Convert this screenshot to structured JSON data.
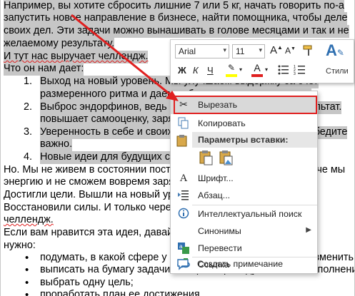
{
  "document": {
    "para1": [
      "Например, вы хотите сбросить лишние 7 или 5 кг, начать говорить по-а",
      "запустить новое направление в бизнесе, найти помощника, чтобы деле",
      "своих дел. Эти задачи можно вынашивать в голове месяцами и так и не",
      "желаемому результату."
    ],
    "line5": "И тут нас выручает челлендж.",
    "line6": "Что он нам дает:",
    "numbered": [
      {
        "n": "1.",
        "lines": [
          "Выход на новый уровень. Мы улучшаем выдержку за счет",
          "размеренного ритма и даем себе импульс для развития."
        ]
      },
      {
        "n": "2.",
        "lines": [
          "Выброс эндорфинов, ведь мы получаем конкретный результат.",
          "повышает самооценку, заряжает энергией."
        ]
      },
      {
        "n": "3.",
        "lines": [
          "Уверенность в себе и своих силах. Вы уже знаете, что победите",
          "важно."
        ]
      },
      {
        "n": "4.",
        "lines": [
          "Новые идеи для будущих свершений."
        ]
      }
    ],
    "para2": [
      "Но. Мы не живем в состоянии постоянного роста и развития. Иначе мы",
      "энергию и не сможем вовремя зарядиться.",
      "Достигли цели. Вышли на новый уровень. Но через время надо",
      "Восстановили силы. И только через время ставим новый стартап",
      "челлендж.",
      "Если вам нравится эта идея, давайте сразу перейдем к делу. Что",
      "нужно:"
    ],
    "bullets": [
      "подумать, в какой сфере у вас есть то, что хотелось бы изменить",
      "выписать на бумагу задачи, которые приведут вас к их выполнению",
      "выбрать одну цель;",
      "проработать план ее достижения"
    ]
  },
  "mini_toolbar": {
    "font_name": "Arial",
    "font_size": "11",
    "grow_font": "A",
    "shrink_font": "A",
    "bold": "Ж",
    "italic": "К",
    "underline": "Ч",
    "font_color_letter": "A",
    "styles_label": "Стили",
    "highlight_color": "#ffff00",
    "font_color": "#e02020"
  },
  "context_menu": {
    "items": [
      {
        "label": "Вырезать",
        "icon": "scissors-icon"
      },
      {
        "label": "Копировать",
        "icon": "copy-icon"
      },
      {
        "label": "Параметры вставки:",
        "icon": "paste-options-header"
      },
      {
        "label": "Шрифт...",
        "icon": "font-icon"
      },
      {
        "label": "Абзац...",
        "icon": "paragraph-icon"
      },
      {
        "label": "Интеллектуальный поиск",
        "icon": "smart-lookup-icon"
      },
      {
        "label": "Синонимы",
        "icon": "synonyms-icon"
      },
      {
        "label": "Перевести",
        "icon": "translate-icon"
      },
      {
        "label": "Ссылка",
        "icon": "link-icon"
      },
      {
        "label": "Создать примечание",
        "icon": "comment-icon"
      }
    ],
    "highlight_box_color": "#e02020"
  }
}
